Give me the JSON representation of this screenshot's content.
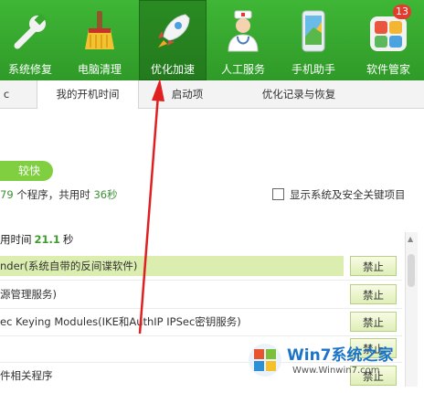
{
  "nav": [
    {
      "label": "系统修复",
      "icon": "wrench-icon"
    },
    {
      "label": "电脑清理",
      "icon": "broom-icon"
    },
    {
      "label": "优化加速",
      "icon": "rocket-icon"
    },
    {
      "label": "人工服务",
      "icon": "doctor-icon"
    },
    {
      "label": "手机助手",
      "icon": "phone-icon"
    },
    {
      "label": "软件管家",
      "icon": "apps-icon",
      "badge": "13"
    }
  ],
  "tabs": [
    "我的开机时间",
    "启动项",
    "优化记录与恢复"
  ],
  "tab_left_fragment": "c",
  "status_pill": "较快",
  "summary": {
    "count": "79",
    "mid": "个程序，共用时",
    "time": "36秒"
  },
  "show_critical": "显示系统及安全关键项目",
  "boot_time": {
    "label": "用时间",
    "value": "21.1",
    "unit": "秒"
  },
  "rows": [
    {
      "name": "nder(系统自带的反间谍软件)",
      "button": "禁止",
      "highlight": true
    },
    {
      "name": "源管理服务)",
      "button": "禁止",
      "highlight": false
    },
    {
      "name": "ec Keying Modules(IKE和AuthIP IPSec密钥服务)",
      "button": "禁止",
      "highlight": false
    },
    {
      "name": "",
      "button": "禁止",
      "highlight": false
    },
    {
      "name": "件相关程序",
      "button": "禁止",
      "highlight": false
    }
  ],
  "watermark": {
    "brand": "Win7系统之家",
    "url": "Www.Winwin7.com"
  },
  "colors": {
    "topbar": "#35a82d",
    "accent_green": "#3d9d2b",
    "arrow": "#e02020"
  }
}
